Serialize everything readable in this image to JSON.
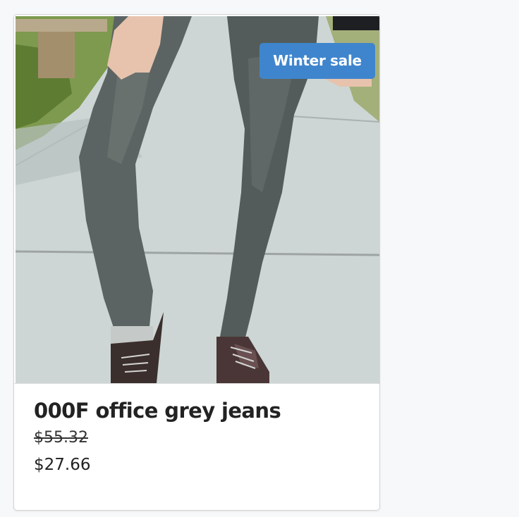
{
  "product": {
    "badge": "Winter sale",
    "title": "000F office grey jeans",
    "original_price": "$55.32",
    "sale_price": "$27.66",
    "image_alt": "Person wearing grey skinny jeans and brown lace-up shoes on a sidewalk"
  },
  "colors": {
    "badge_background": "#3f85cd",
    "badge_text": "#ffffff",
    "title_text": "#222222",
    "page_background": "#f7f8fa"
  }
}
